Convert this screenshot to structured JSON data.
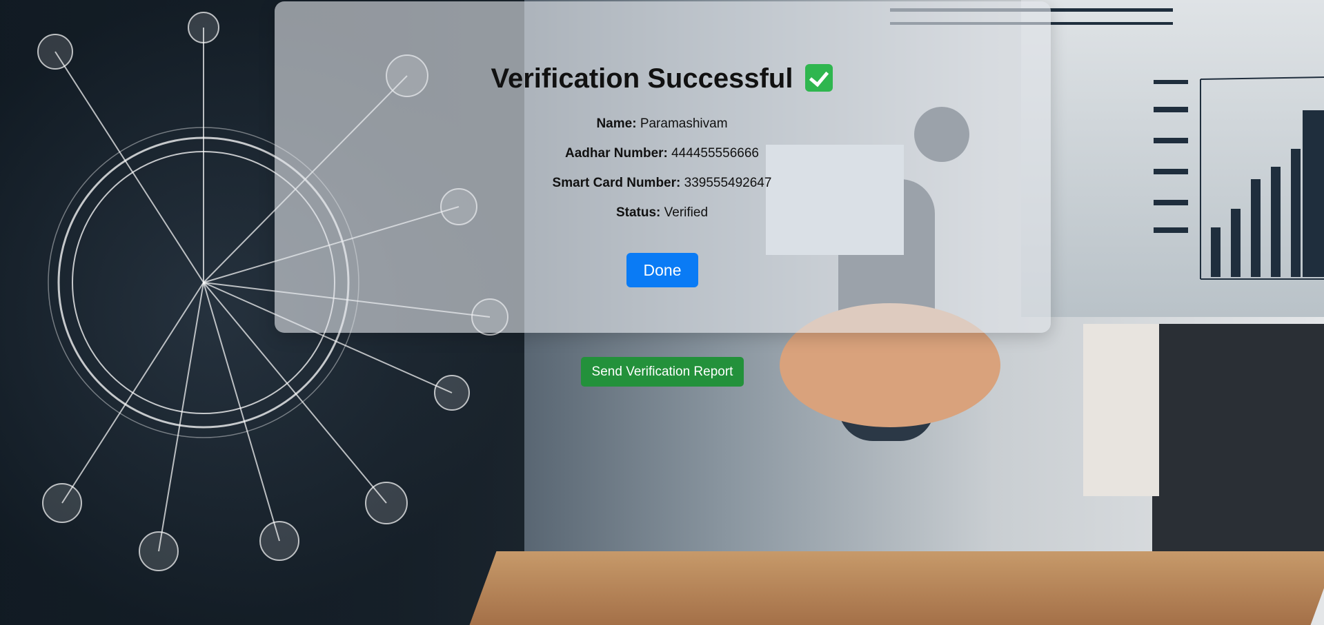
{
  "verification": {
    "title": "Verification Successful",
    "check_icon": "white-check-mark-icon",
    "fields": [
      {
        "label": "Name:",
        "value": "Paramashivam"
      },
      {
        "label": "Aadhar Number:",
        "value": "444455556666"
      },
      {
        "label": "Smart Card Number:",
        "value": "339555492647"
      },
      {
        "label": "Status:",
        "value": "Verified"
      }
    ],
    "done_label": "Done",
    "report_label": "Send Verification Report"
  },
  "colors": {
    "done_button": "#0a7bf5",
    "report_button": "#23913b",
    "check_icon": "#2fb64f"
  }
}
